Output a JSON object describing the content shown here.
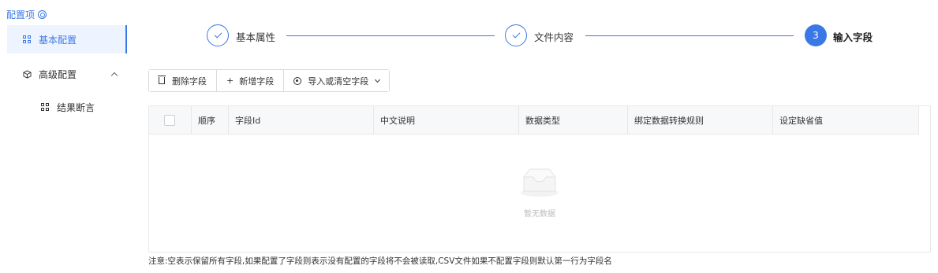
{
  "sidebar": {
    "title": "配置项",
    "items": [
      {
        "label": "基本配置"
      },
      {
        "label": "高级配置"
      },
      {
        "label": "结果断言"
      }
    ]
  },
  "steps": [
    {
      "label": "基本属性",
      "state": "done"
    },
    {
      "label": "文件内容",
      "state": "done"
    },
    {
      "label": "输入字段",
      "state": "current",
      "number": "3"
    }
  ],
  "toolbar": {
    "delete_label": "删除字段",
    "add_label": "新增字段",
    "import_label": "导入或清空字段"
  },
  "table": {
    "columns": [
      "顺序",
      "字段Id",
      "中文说明",
      "数据类型",
      "绑定数据转换规则",
      "设定缺省值"
    ],
    "empty_text": "暂无数据"
  },
  "note": "注意:空表示保留所有字段,如果配置了字段则表示没有配置的字段将不会被读取,CSV文件如果不配置字段则默认第一行为字段名",
  "colors": {
    "accent": "#3b78e7",
    "border": "#e8e8e8",
    "header_bg": "#f7f8fa"
  }
}
